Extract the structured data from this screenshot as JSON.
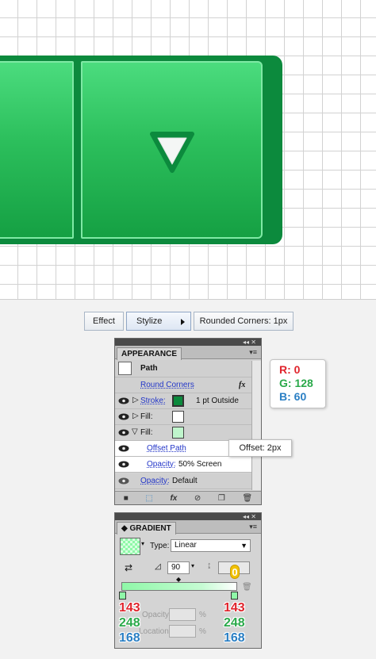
{
  "colors": {
    "accent_green": "#0c8a3d",
    "red": "#e0242c",
    "green": "#2aa94a",
    "blue": "#2a7fc4"
  },
  "menu": {
    "effect": "Effect",
    "stylize": "Stylize",
    "rounded": "Rounded Corners: 1px"
  },
  "appearance": {
    "tab": "APPEARANCE",
    "object": "Path",
    "rows": {
      "round_corners": "Round Corners",
      "stroke_label": "Stroke:",
      "stroke_value": "1 pt  Outside",
      "fill1_label": "Fill:",
      "fill2_label": "Fill:",
      "offset_path": "Offset Path",
      "opacity_label": "Opacity:",
      "opacity_value": "50% Screen",
      "opacity2_label": "Opacity:",
      "opacity2_value": "Default"
    },
    "fx": "fx"
  },
  "offset_callout": "Offset: 2px",
  "rgb": {
    "r": "R: 0",
    "g": "G: 128",
    "b": "B: 60"
  },
  "gradient": {
    "tab": "GRADIENT",
    "type_label": "Type:",
    "type_value": "Linear",
    "angle": "90",
    "aspect_badge": "0",
    "opacity_label": "Opacity:",
    "location_label": "Location:",
    "pct": "%",
    "left": {
      "r": "143",
      "g": "248",
      "b": "168"
    },
    "right": {
      "r": "143",
      "g": "248",
      "b": "168"
    }
  }
}
